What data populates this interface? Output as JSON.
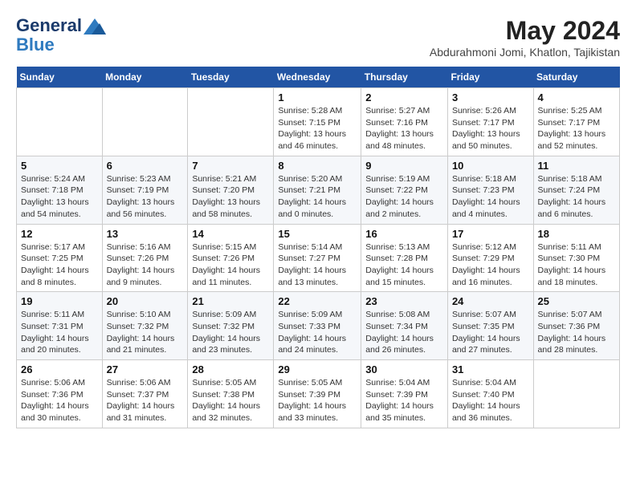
{
  "header": {
    "logo_line1": "General",
    "logo_line2": "Blue",
    "month_year": "May 2024",
    "location": "Abdurahmoni Jomi, Khatlon, Tajikistan"
  },
  "weekdays": [
    "Sunday",
    "Monday",
    "Tuesday",
    "Wednesday",
    "Thursday",
    "Friday",
    "Saturday"
  ],
  "weeks": [
    [
      {
        "day": "",
        "sunrise": "",
        "sunset": "",
        "daylight": ""
      },
      {
        "day": "",
        "sunrise": "",
        "sunset": "",
        "daylight": ""
      },
      {
        "day": "",
        "sunrise": "",
        "sunset": "",
        "daylight": ""
      },
      {
        "day": "1",
        "sunrise": "Sunrise: 5:28 AM",
        "sunset": "Sunset: 7:15 PM",
        "daylight": "Daylight: 13 hours and 46 minutes."
      },
      {
        "day": "2",
        "sunrise": "Sunrise: 5:27 AM",
        "sunset": "Sunset: 7:16 PM",
        "daylight": "Daylight: 13 hours and 48 minutes."
      },
      {
        "day": "3",
        "sunrise": "Sunrise: 5:26 AM",
        "sunset": "Sunset: 7:17 PM",
        "daylight": "Daylight: 13 hours and 50 minutes."
      },
      {
        "day": "4",
        "sunrise": "Sunrise: 5:25 AM",
        "sunset": "Sunset: 7:17 PM",
        "daylight": "Daylight: 13 hours and 52 minutes."
      }
    ],
    [
      {
        "day": "5",
        "sunrise": "Sunrise: 5:24 AM",
        "sunset": "Sunset: 7:18 PM",
        "daylight": "Daylight: 13 hours and 54 minutes."
      },
      {
        "day": "6",
        "sunrise": "Sunrise: 5:23 AM",
        "sunset": "Sunset: 7:19 PM",
        "daylight": "Daylight: 13 hours and 56 minutes."
      },
      {
        "day": "7",
        "sunrise": "Sunrise: 5:21 AM",
        "sunset": "Sunset: 7:20 PM",
        "daylight": "Daylight: 13 hours and 58 minutes."
      },
      {
        "day": "8",
        "sunrise": "Sunrise: 5:20 AM",
        "sunset": "Sunset: 7:21 PM",
        "daylight": "Daylight: 14 hours and 0 minutes."
      },
      {
        "day": "9",
        "sunrise": "Sunrise: 5:19 AM",
        "sunset": "Sunset: 7:22 PM",
        "daylight": "Daylight: 14 hours and 2 minutes."
      },
      {
        "day": "10",
        "sunrise": "Sunrise: 5:18 AM",
        "sunset": "Sunset: 7:23 PM",
        "daylight": "Daylight: 14 hours and 4 minutes."
      },
      {
        "day": "11",
        "sunrise": "Sunrise: 5:18 AM",
        "sunset": "Sunset: 7:24 PM",
        "daylight": "Daylight: 14 hours and 6 minutes."
      }
    ],
    [
      {
        "day": "12",
        "sunrise": "Sunrise: 5:17 AM",
        "sunset": "Sunset: 7:25 PM",
        "daylight": "Daylight: 14 hours and 8 minutes."
      },
      {
        "day": "13",
        "sunrise": "Sunrise: 5:16 AM",
        "sunset": "Sunset: 7:26 PM",
        "daylight": "Daylight: 14 hours and 9 minutes."
      },
      {
        "day": "14",
        "sunrise": "Sunrise: 5:15 AM",
        "sunset": "Sunset: 7:26 PM",
        "daylight": "Daylight: 14 hours and 11 minutes."
      },
      {
        "day": "15",
        "sunrise": "Sunrise: 5:14 AM",
        "sunset": "Sunset: 7:27 PM",
        "daylight": "Daylight: 14 hours and 13 minutes."
      },
      {
        "day": "16",
        "sunrise": "Sunrise: 5:13 AM",
        "sunset": "Sunset: 7:28 PM",
        "daylight": "Daylight: 14 hours and 15 minutes."
      },
      {
        "day": "17",
        "sunrise": "Sunrise: 5:12 AM",
        "sunset": "Sunset: 7:29 PM",
        "daylight": "Daylight: 14 hours and 16 minutes."
      },
      {
        "day": "18",
        "sunrise": "Sunrise: 5:11 AM",
        "sunset": "Sunset: 7:30 PM",
        "daylight": "Daylight: 14 hours and 18 minutes."
      }
    ],
    [
      {
        "day": "19",
        "sunrise": "Sunrise: 5:11 AM",
        "sunset": "Sunset: 7:31 PM",
        "daylight": "Daylight: 14 hours and 20 minutes."
      },
      {
        "day": "20",
        "sunrise": "Sunrise: 5:10 AM",
        "sunset": "Sunset: 7:32 PM",
        "daylight": "Daylight: 14 hours and 21 minutes."
      },
      {
        "day": "21",
        "sunrise": "Sunrise: 5:09 AM",
        "sunset": "Sunset: 7:32 PM",
        "daylight": "Daylight: 14 hours and 23 minutes."
      },
      {
        "day": "22",
        "sunrise": "Sunrise: 5:09 AM",
        "sunset": "Sunset: 7:33 PM",
        "daylight": "Daylight: 14 hours and 24 minutes."
      },
      {
        "day": "23",
        "sunrise": "Sunrise: 5:08 AM",
        "sunset": "Sunset: 7:34 PM",
        "daylight": "Daylight: 14 hours and 26 minutes."
      },
      {
        "day": "24",
        "sunrise": "Sunrise: 5:07 AM",
        "sunset": "Sunset: 7:35 PM",
        "daylight": "Daylight: 14 hours and 27 minutes."
      },
      {
        "day": "25",
        "sunrise": "Sunrise: 5:07 AM",
        "sunset": "Sunset: 7:36 PM",
        "daylight": "Daylight: 14 hours and 28 minutes."
      }
    ],
    [
      {
        "day": "26",
        "sunrise": "Sunrise: 5:06 AM",
        "sunset": "Sunset: 7:36 PM",
        "daylight": "Daylight: 14 hours and 30 minutes."
      },
      {
        "day": "27",
        "sunrise": "Sunrise: 5:06 AM",
        "sunset": "Sunset: 7:37 PM",
        "daylight": "Daylight: 14 hours and 31 minutes."
      },
      {
        "day": "28",
        "sunrise": "Sunrise: 5:05 AM",
        "sunset": "Sunset: 7:38 PM",
        "daylight": "Daylight: 14 hours and 32 minutes."
      },
      {
        "day": "29",
        "sunrise": "Sunrise: 5:05 AM",
        "sunset": "Sunset: 7:39 PM",
        "daylight": "Daylight: 14 hours and 33 minutes."
      },
      {
        "day": "30",
        "sunrise": "Sunrise: 5:04 AM",
        "sunset": "Sunset: 7:39 PM",
        "daylight": "Daylight: 14 hours and 35 minutes."
      },
      {
        "day": "31",
        "sunrise": "Sunrise: 5:04 AM",
        "sunset": "Sunset: 7:40 PM",
        "daylight": "Daylight: 14 hours and 36 minutes."
      },
      {
        "day": "",
        "sunrise": "",
        "sunset": "",
        "daylight": ""
      }
    ]
  ]
}
